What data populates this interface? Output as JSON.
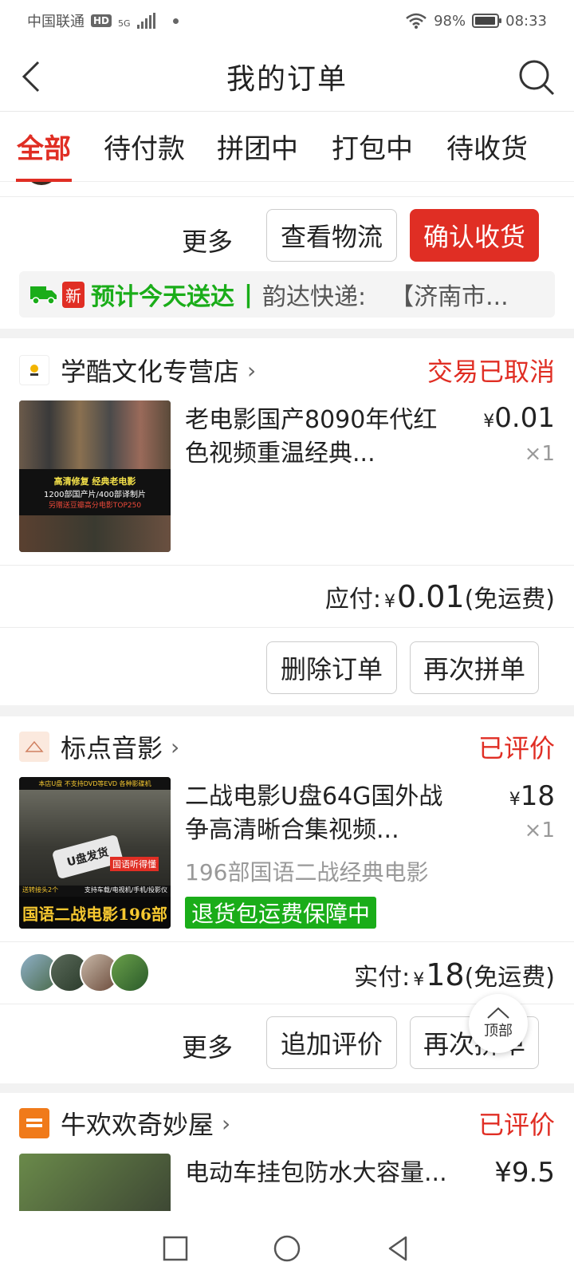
{
  "status_bar": {
    "carrier": "中国联通",
    "hd": "HD",
    "network": "5G",
    "battery": "98%",
    "time": "08:33"
  },
  "header": {
    "title": "我的订单"
  },
  "tabs": [
    {
      "label": "全部"
    },
    {
      "label": "待付款"
    },
    {
      "label": "拼团中"
    },
    {
      "label": "打包中"
    },
    {
      "label": "待收货"
    }
  ],
  "order1": {
    "more": "更多",
    "btn_logistics": "查看物流",
    "btn_confirm": "确认收货",
    "logistics": {
      "new": "新",
      "eta": "预计今天送达",
      "divider": "|",
      "courier": "韵达快递:",
      "location": "【济南市..."
    }
  },
  "order2": {
    "shop": "学酷文化专营店",
    "status": "交易已取消",
    "title": "老电影国产8090年代红色视频重温经典...",
    "price_sym": "¥",
    "price": "0.01",
    "qty": "×1",
    "pay_label": "应付:",
    "pay_sym": "¥",
    "pay_amount": "0.01",
    "pay_note": "(免运费)",
    "btn_delete": "删除订单",
    "btn_again": "再次拼单",
    "thumb_text": {
      "l1": "高清修复 经典老电影",
      "l2": "1200部国产片/400部译制片",
      "l3": "另赠送豆瓣高分电影TOP250"
    }
  },
  "order3": {
    "shop": "标点音影",
    "status": "已评价",
    "title": "二战电影U盘64G国外战争高清晰合集视频...",
    "price_sym": "¥",
    "price": "18",
    "qty": "×1",
    "spec": "196部国语二战经典电影",
    "tag": "退货包运费保障中",
    "pay_label": "实付:",
    "pay_sym": "¥",
    "pay_amount": "18",
    "pay_note": "(免运费)",
    "more": "更多",
    "btn_review": "追加评价",
    "btn_again": "再次拼单",
    "thumb_text": {
      "banner": "本店U盘 不支持DVD等EVD 各种影碟机",
      "usb": "U盘发货",
      "lang": "国语听得懂",
      "gift": "送转接头2个",
      "devices": "支持车载/电视机/手机/投影仪",
      "big": "国语二战电影196部"
    }
  },
  "order4": {
    "shop": "牛欢欢奇妙屋",
    "status": "已评价",
    "title": "电动车挂包防水大容量...",
    "price": "¥9.5"
  },
  "to_top": "顶部",
  "colors": {
    "accent": "#e02e24",
    "green": "#1aad19"
  }
}
